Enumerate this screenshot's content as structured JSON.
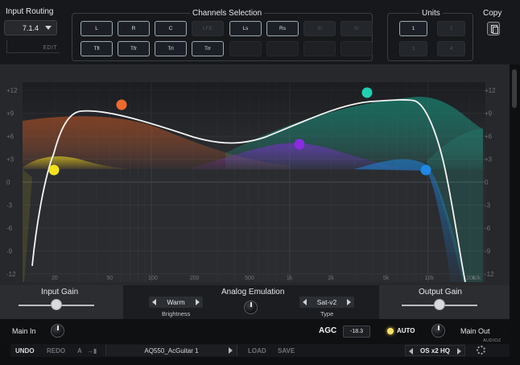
{
  "input_routing": {
    "title": "Input Routing",
    "value": "7.1.4",
    "edit_label": "EDIT"
  },
  "channels": {
    "title": "Channels Selection",
    "row1": [
      {
        "label": "L",
        "state": "on"
      },
      {
        "label": "R",
        "state": "on"
      },
      {
        "label": "C",
        "state": "on"
      },
      {
        "label": "LFE",
        "state": "off"
      },
      {
        "label": "Ls",
        "state": "on"
      },
      {
        "label": "Rs",
        "state": "on"
      },
      {
        "label": "Sl",
        "state": "off"
      },
      {
        "label": "Sr",
        "state": "off"
      }
    ],
    "row2": [
      {
        "label": "Tfl",
        "state": "on"
      },
      {
        "label": "Tfr",
        "state": "on"
      },
      {
        "label": "Trl",
        "state": "on"
      },
      {
        "label": "Trr",
        "state": "on"
      },
      {
        "label": "",
        "state": "empty"
      },
      {
        "label": "",
        "state": "empty"
      },
      {
        "label": "",
        "state": "empty"
      },
      {
        "label": "",
        "state": "empty"
      }
    ]
  },
  "units": {
    "title": "Units",
    "buttons": [
      {
        "label": "1",
        "state": "on"
      },
      {
        "label": "2",
        "state": "off"
      },
      {
        "label": "3",
        "state": "off"
      },
      {
        "label": "4",
        "state": "off"
      }
    ]
  },
  "copy": {
    "title": "Copy"
  },
  "graph": {
    "y_ticks": [
      "+12",
      "+9",
      "+6",
      "+3",
      "0",
      "-3",
      "-6",
      "-9",
      "-12"
    ],
    "x_ticks": [
      "20",
      "50",
      "100",
      "200",
      "500",
      "1k",
      "2k",
      "5k",
      "10k",
      "20k",
      "40k"
    ],
    "band_colors": {
      "yellow": "#f2e21a",
      "orange": "#f06a2c",
      "purple": "#8a2be2",
      "teal": "#1fd1b0",
      "blue": "#1e88e5"
    }
  },
  "input_gain": {
    "label": "Input Gain",
    "level": 0.5
  },
  "analog": {
    "title": "Analog Emulation",
    "brightness_value": "Warm",
    "brightness_label": "Brightness",
    "type_value": "Sat-v2",
    "type_label": "Type"
  },
  "output_gain": {
    "label": "Output Gain",
    "level": 0.5
  },
  "io": {
    "main_in": "Main In",
    "agc_label": "AGC",
    "agc_value": "-18.3",
    "auto_label": "AUTO",
    "main_out": "Main Out",
    "logo": "AUDIOZ"
  },
  "footer": {
    "undo": "UNDO",
    "redo": "REDO",
    "ab": "A",
    "preset_name": "AQ550_AcGuitar 1",
    "load": "LOAD",
    "save": "SAVE",
    "oversampling": "OS x2 HQ"
  }
}
